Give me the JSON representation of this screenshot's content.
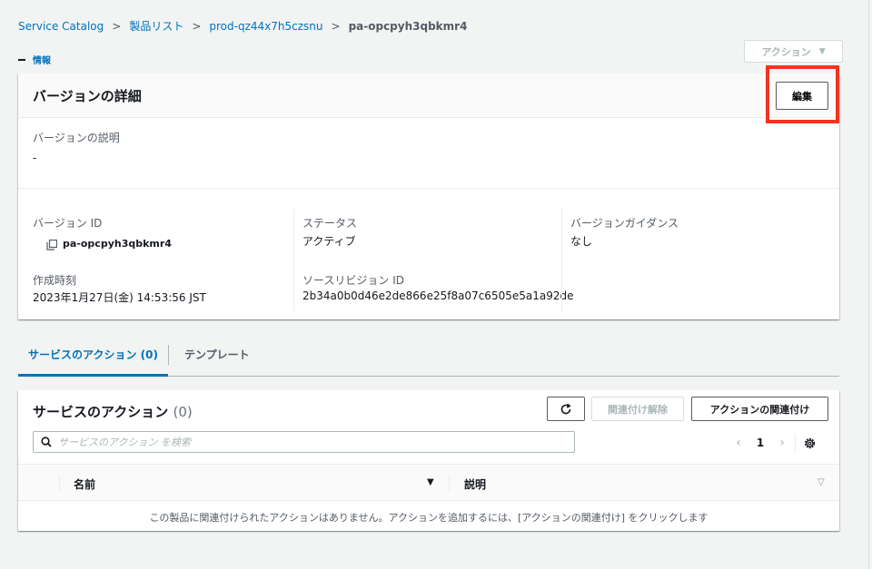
{
  "breadcrumb": {
    "items": [
      "Service Catalog",
      "製品リスト",
      "prod-qz44x7h5czsnu",
      "pa-opcpyh3qbkmr4"
    ],
    "separator": ">"
  },
  "header": {
    "actions_label": "アクション",
    "actions_caret": "▼",
    "info_label": "情報"
  },
  "details": {
    "title": "バージョンの詳細",
    "edit_label": "編集",
    "description_label": "バージョンの説明",
    "description_value": "-",
    "version_id_label": "バージョン ID",
    "version_id_value": "pa-opcpyh3qbkmr4",
    "status_label": "ステータス",
    "status_value": "アクティブ",
    "guidance_label": "バージョンガイダンス",
    "guidance_value": "なし",
    "created_label": "作成時刻",
    "created_value": "2023年1月27日(金) 14:53:56 JST",
    "revision_label": "ソースリビジョン ID",
    "revision_value": "2b34a0b0d46e2de866e25f8a07c6505e5a1a92de"
  },
  "tabs": [
    {
      "label": "サービスのアクション (0)",
      "active": true
    },
    {
      "label": "テンプレート",
      "active": false
    }
  ],
  "service_actions": {
    "title": "サービスのアクション",
    "count": "(0)",
    "disassociate_label": "関連付け解除",
    "associate_label": "アクションの関連付け",
    "search_placeholder": "サービスのアクション を検索",
    "page": "1",
    "columns": [
      "名前",
      "説明"
    ],
    "empty_message": "この製品に関連付けられたアクションはありません。アクションを追加するには、[アクションの関連付け] をクリックします"
  },
  "colors": {
    "link": "#0073bb",
    "highlight": "#f5331e",
    "text": "#16191f",
    "muted": "#545b64"
  },
  "icons": [
    "copy-icon",
    "refresh-icon",
    "search-icon",
    "chevron-left-icon",
    "chevron-right-icon",
    "gear-icon"
  ]
}
